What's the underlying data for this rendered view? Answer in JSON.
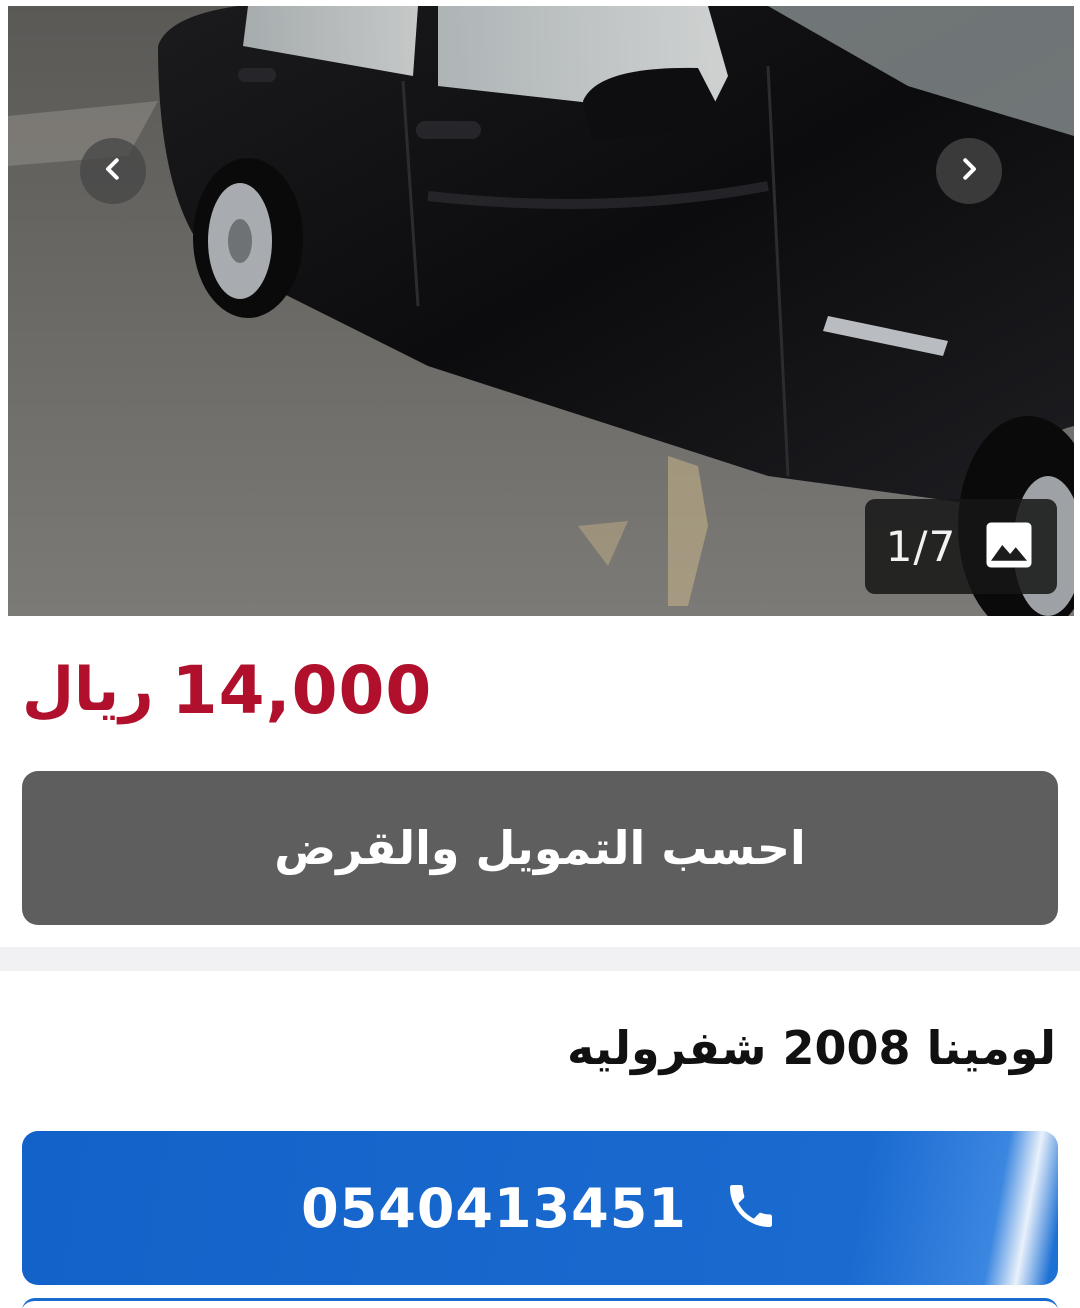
{
  "listing": {
    "title": "لومينا 2008 شفروليه",
    "gallery": {
      "current_image": 1,
      "total_images": 7,
      "counter_text": "1/7"
    },
    "price": {
      "amount": "14,000",
      "currency": "ريال"
    },
    "finance_button_label": "احسب التمويل والقرض",
    "phone_number": "0540413451"
  },
  "icons": {
    "prev": "chevron-left-icon",
    "next": "chevron-right-icon",
    "gallery": "image-icon",
    "phone": "phone-icon"
  },
  "colors": {
    "price": "#b0102c",
    "finance_button": "#5e5e5e",
    "call_button": "#1a6ad0",
    "divider": "#f1f1f3"
  }
}
